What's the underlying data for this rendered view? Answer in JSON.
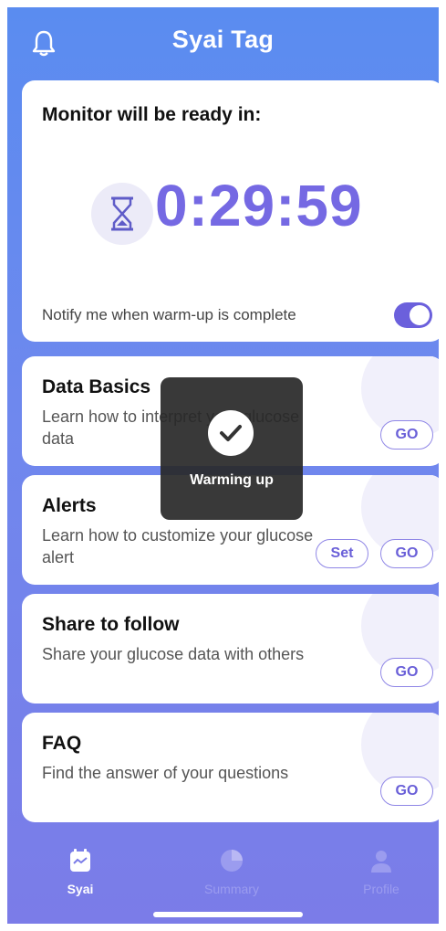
{
  "header": {
    "title": "Syai Tag",
    "bell_icon": "bell-icon"
  },
  "monitor": {
    "title": "Monitor will be ready in:",
    "countdown": "0:29:59",
    "notify_label": "Notify me when warm-up is complete",
    "notify_enabled": true
  },
  "cards": [
    {
      "title": "Data Basics",
      "desc": "Learn how to interpret your glucose data",
      "go": "GO"
    },
    {
      "title": "Alerts",
      "desc": "Learn how to customize your glucose alert",
      "set": "Set",
      "go": "GO"
    },
    {
      "title": "Share to follow",
      "desc": "Share your glucose data with others",
      "go": "GO"
    },
    {
      "title": "FAQ",
      "desc": "Find the answer of your questions",
      "go": "GO"
    }
  ],
  "toast": {
    "label": "Warming up",
    "icon": "check-icon"
  },
  "tabs": [
    {
      "label": "Syai",
      "icon": "calendar-icon",
      "active": true
    },
    {
      "label": "Summary",
      "icon": "pie-chart-icon",
      "active": false
    },
    {
      "label": "Profile",
      "icon": "person-icon",
      "active": false
    }
  ],
  "colors": {
    "accent": "#7569e3",
    "background_top": "#5a8cf0",
    "background_bottom": "#7b7ce8"
  }
}
